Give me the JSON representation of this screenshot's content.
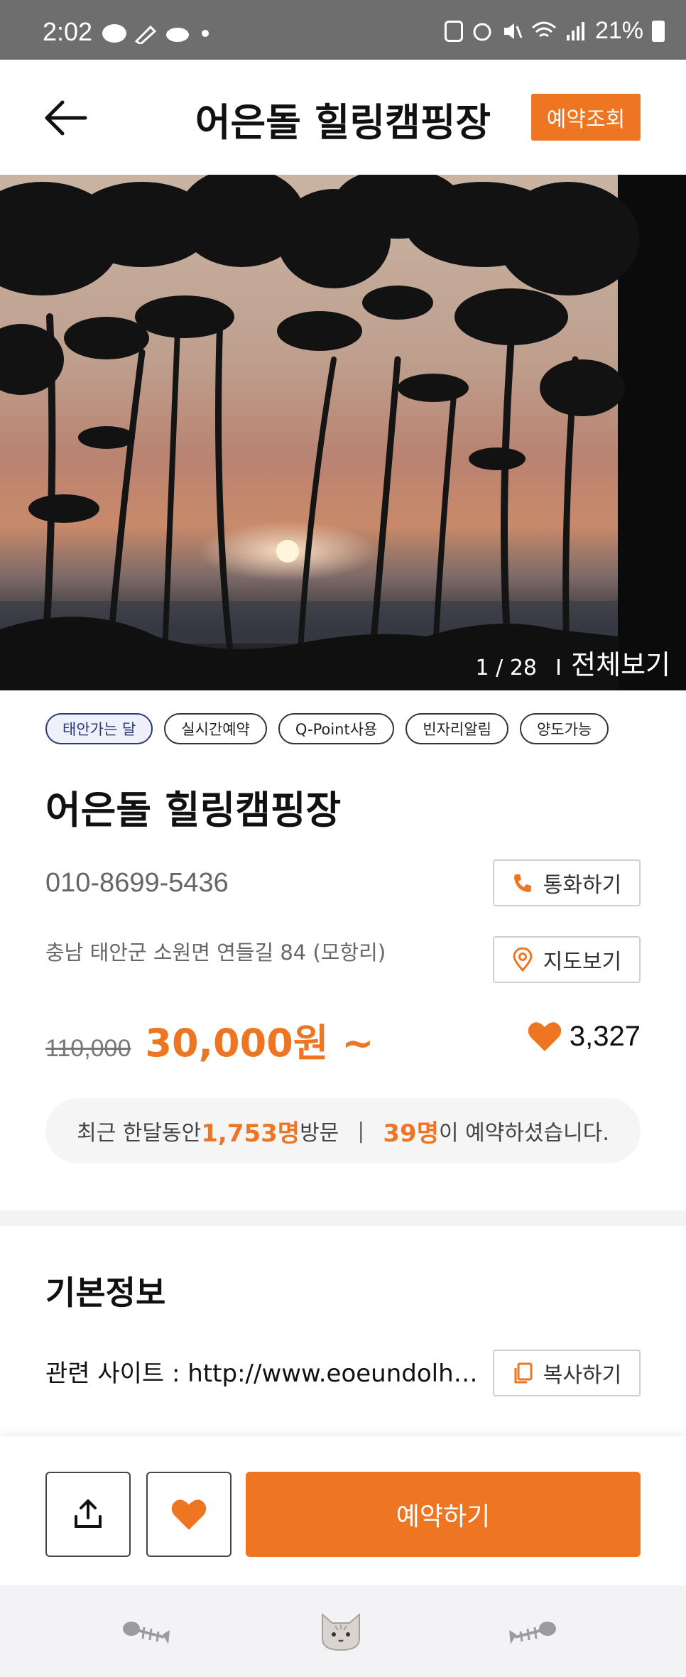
{
  "status_bar": {
    "time": "2:02",
    "battery": "21%"
  },
  "header": {
    "title": "어은돌 힐링캠핑장",
    "reserve_check_label": "예약조회"
  },
  "gallery": {
    "counter": "1 / 28",
    "view_all_label": "전체보기"
  },
  "tags": [
    "태안가는 달",
    "실시간예약",
    "Q-Point사용",
    "빈자리알림",
    "양도가능"
  ],
  "campsite": {
    "name": "어은돌 힐링캠핑장",
    "phone": "010-8699-5436",
    "call_label": "통화하기",
    "address": "충남 태안군 소원면 연들길 84 (모항리)",
    "map_label": "지도보기",
    "original_price": "110,000",
    "price": "30,000원 ~",
    "likes": "3,327"
  },
  "visits": {
    "prefix": "최근 한달동안 ",
    "visitors": "1,753명",
    "visitors_suffix": "방문",
    "separator": "|",
    "bookings": "39명",
    "bookings_suffix": "이 예약하셨습니다."
  },
  "basic_info": {
    "title": "기본정보",
    "site_label": "관련 사이트 : ",
    "site_url": "http://www.eoeundolhealingcamping.com",
    "copy_label": "복사하기"
  },
  "action_bar": {
    "book_label": "예약하기"
  },
  "colors": {
    "accent": "#ee7521",
    "tag_highlight": "#2b3a7a"
  },
  "tabbar": {
    "icons": [
      "fishbone-icon",
      "cat-face-icon",
      "fishbone-icon"
    ]
  }
}
